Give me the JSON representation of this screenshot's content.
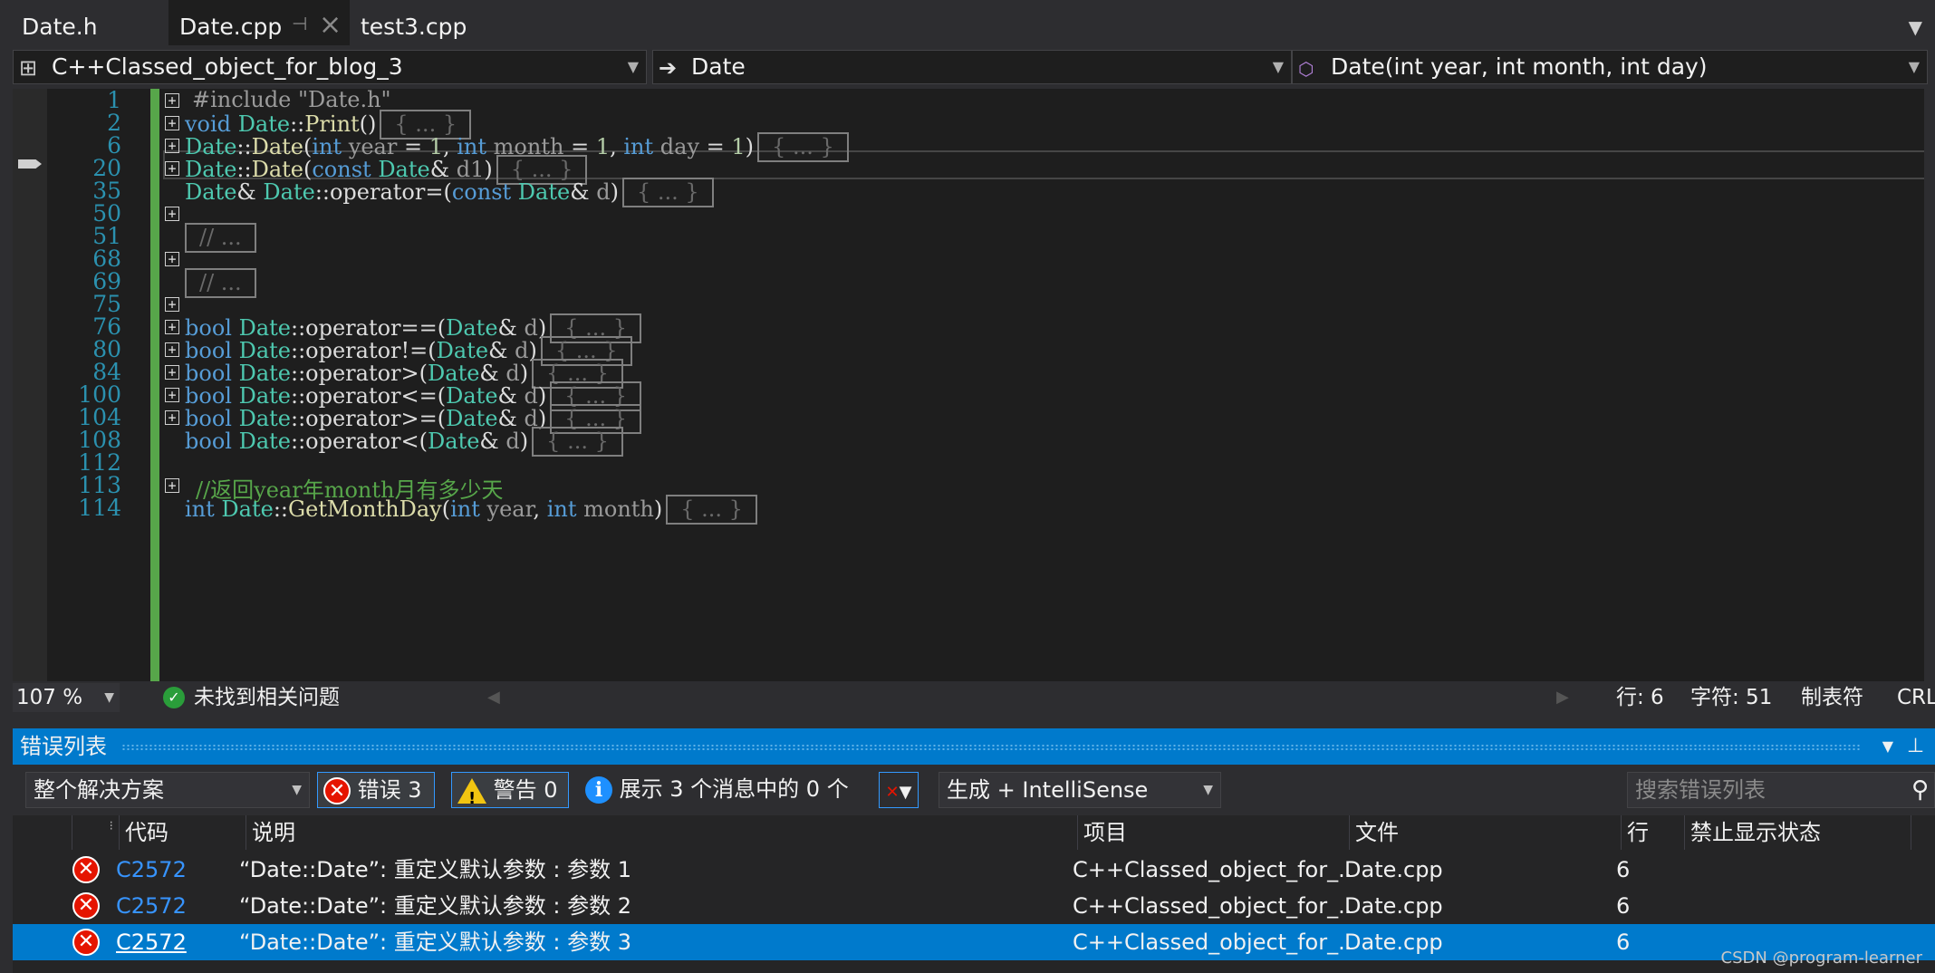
{
  "tabs": [
    {
      "label": "Date.h",
      "active": false
    },
    {
      "label": "Date.cpp",
      "active": true
    },
    {
      "label": "test3.cpp",
      "active": false
    }
  ],
  "icons": {
    "pin": "pin-icon",
    "close": "close-icon",
    "overflow": "chevron-down-icon"
  },
  "navbar": {
    "project": "C++Classed_object_for_blog_3",
    "scope": "Date",
    "member": "Date(int year, int month, int day)"
  },
  "editor": {
    "line_numbers": [
      "1",
      "2",
      "6",
      "20",
      "35",
      "50",
      "51",
      "68",
      "69",
      "75",
      "76",
      "80",
      "84",
      "100",
      "104",
      "108",
      "112",
      "113",
      "114"
    ],
    "folded_placeholder": "{ ... }",
    "folded_comment": "// ...",
    "lines": {
      "l1": "#include \"Date.h\"",
      "l2_kw": "void",
      "l2_cls": "Date",
      "l2_fn": "Print",
      "l6_cls": "Date",
      "l6_fn": "Date",
      "l6_kw": "int",
      "l6_p1": "year",
      "l6_p2": "month",
      "l6_p3": "day",
      "l6_num": "1",
      "l20_cls": "Date",
      "l20_fn": "Date",
      "l20_kw": "const",
      "l20_ty": "Date",
      "l20_p": "d1",
      "l35_ty": "Date",
      "l35_cls": "Date",
      "l35_op": "operator=",
      "l35_kw": "const",
      "l35_ty2": "Date",
      "l35_p": "d",
      "bool_kw": "bool",
      "op_eq": "operator==",
      "op_ne": "operator!=",
      "op_gt": "operator>",
      "op_le": "operator<=",
      "op_ge": "operator>=",
      "op_lt": "operator<",
      "l113_comment": "//返回year年month月有多少天",
      "l114_kw": "int",
      "l114_fn": "GetMonthDay",
      "l114_p1": "year",
      "l114_p2": "month"
    }
  },
  "status": {
    "zoom": "107 %",
    "issues": "未找到相关问题",
    "line": "行: 6",
    "char": "字符: 51",
    "tabs": "制表符",
    "eol": "CRL"
  },
  "error_list": {
    "title": "错误列表",
    "scope": "整个解决方案",
    "errors_btn": "错误 3",
    "warnings_btn": "警告 0",
    "messages_btn": "展示 3 个消息中的 0 个",
    "build_filter": "生成 + IntelliSense",
    "search_placeholder": "搜索错误列表",
    "columns": [
      "代码",
      "说明",
      "项目",
      "文件",
      "行",
      "禁止显示状态"
    ],
    "rows": [
      {
        "code": "C2572",
        "desc": "“Date::Date”: 重定义默认参数 : 参数 1",
        "project": "C++Classed_object_for_...",
        "file": "Date.cpp",
        "line": "6",
        "selected": false
      },
      {
        "code": "C2572",
        "desc": "“Date::Date”: 重定义默认参数 : 参数 2",
        "project": "C++Classed_object_for_...",
        "file": "Date.cpp",
        "line": "6",
        "selected": false
      },
      {
        "code": "C2572",
        "desc": "“Date::Date”: 重定义默认参数 : 参数 3",
        "project": "C++Classed_object_for_...",
        "file": "Date.cpp",
        "line": "6",
        "selected": true
      }
    ]
  },
  "watermark": "CSDN @program-learner",
  "colors": {
    "accent": "#007acc",
    "editor_bg": "#1e1e1e",
    "error": "#e51400",
    "keyword": "#569cd6",
    "type": "#4ec9b0",
    "comment": "#57a64a"
  }
}
